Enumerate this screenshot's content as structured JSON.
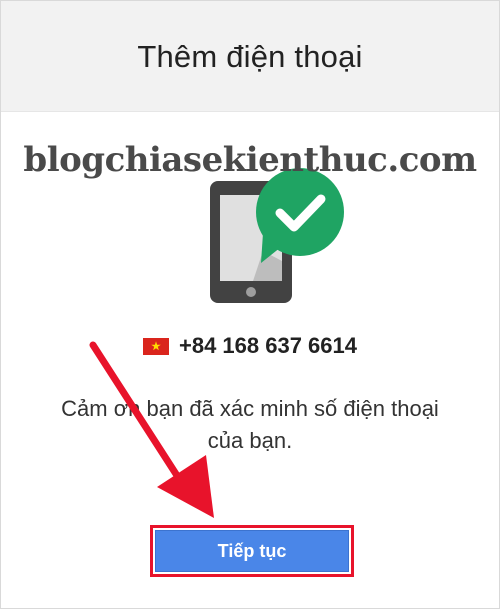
{
  "dialog": {
    "title": "Thêm điện thoại",
    "phone_number": "+84 168 637 6614",
    "message_line1": "Cảm ơn bạn đã xác minh số điện thoại",
    "message_line2": "của bạn.",
    "continue_label": "Tiếp tục"
  },
  "watermark": {
    "text": "blogchiasekienthuc.com"
  },
  "icons": {
    "illustration": "phone-verified-icon",
    "flag": "vietnam-flag-icon",
    "arrow": "red-arrow-annotation"
  },
  "colors": {
    "header_bg": "#f2f2f2",
    "button_bg": "#4a86e8",
    "check_bubble": "#1fa463",
    "highlight_red": "#e8132b"
  }
}
